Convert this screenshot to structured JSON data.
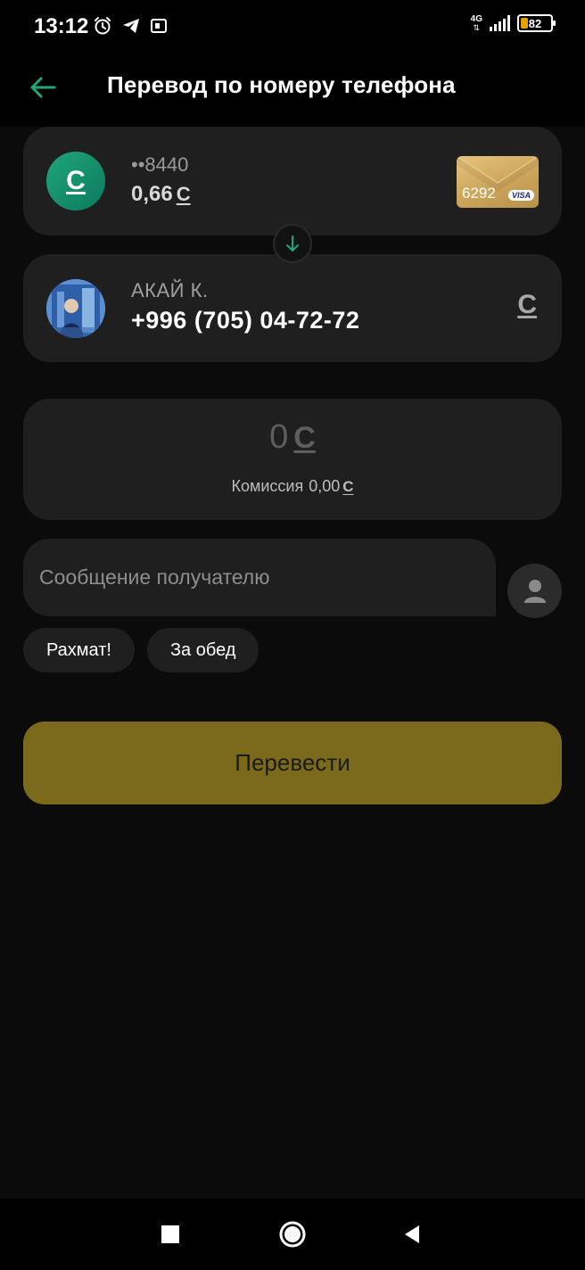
{
  "status_bar": {
    "time": "13:12",
    "network": "4G",
    "battery": "82",
    "icons": [
      "alarm-icon",
      "telegram-icon",
      "notification-icon",
      "signal-icon",
      "battery-icon"
    ]
  },
  "header": {
    "title": "Перевод по номеру телефона",
    "back_icon": "arrow-left-icon"
  },
  "from_account": {
    "masked_number": "••8440",
    "balance": "0,66",
    "currency_symbol": "С",
    "card_last_digits": "6292",
    "card_network": "VISA"
  },
  "to_recipient": {
    "name": "АКАЙ К.",
    "phone": "+996 (705) 04-72-72",
    "currency_symbol": "С"
  },
  "amount": {
    "value": "0",
    "currency_symbol": "С",
    "commission_label": "Комиссия",
    "commission_value": "0,00"
  },
  "message": {
    "placeholder": "Сообщение получателю",
    "value": ""
  },
  "quick_messages": [
    "Рахмат!",
    "За обед"
  ],
  "submit": {
    "label": "Перевести"
  },
  "colors": {
    "background": "#0b0b0b",
    "card": "#1f1f1f",
    "accent_green": "#1fa67a",
    "submit_button": "#7b6a1c"
  }
}
